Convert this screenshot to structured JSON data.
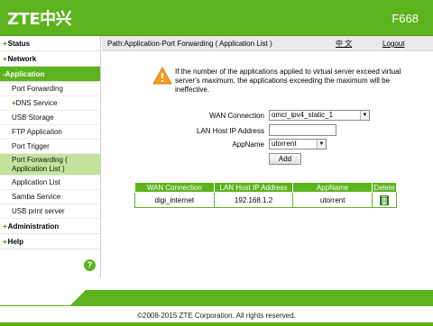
{
  "header": {
    "logo": "ZTE中兴",
    "model": "F668"
  },
  "sidebar": {
    "sections": {
      "status": "Status",
      "network": "Network",
      "application": "-Application",
      "administration": "Administration",
      "help": "Help"
    },
    "plus_sign": "+",
    "items": {
      "port_forwarding": "Port Forwarding",
      "dns_service": "DNS Service",
      "usb_storage": "USB Storage",
      "ftp_application": "FTP Application",
      "port_trigger": "Port Trigger",
      "pf_app_list_line1": "Port Forwarding (",
      "pf_app_list_line2": "Application List )",
      "application_list": "Application List",
      "samba_service": "Samba Service",
      "usb_print_server": "USB print server"
    },
    "help_icon_glyph": "?"
  },
  "pathbar": {
    "path": "Path:Application-Port Forwarding ( Application List )",
    "language": "中 文",
    "logout": "Logout"
  },
  "warning": {
    "icon": "warning-triangle-icon",
    "text": "If the number of the applications applied to virtual server exceed virtual server's maximum, the applications exceeding the maximum will be ineffective."
  },
  "form": {
    "wan_label": "WAN Connection",
    "wan_value": "omci_ipv4_static_1",
    "lan_label": "LAN Host IP Address",
    "lan_value": "",
    "app_label": "AppName",
    "app_value": "utorrent",
    "add_button": "Add"
  },
  "table": {
    "headers": [
      "WAN Connection",
      "LAN Host IP Address",
      "AppName",
      "Delete"
    ],
    "rows": [
      [
        "digi_internet",
        "192.168.1.2",
        "utorrent"
      ]
    ]
  },
  "footer": {
    "copyright": "©2008-2015 ZTE Corporation. All rights reserved."
  },
  "colors": {
    "brand_green": "#5db31e",
    "selected_item": "#c3e39d",
    "warning_orange": "#f39c1f"
  }
}
